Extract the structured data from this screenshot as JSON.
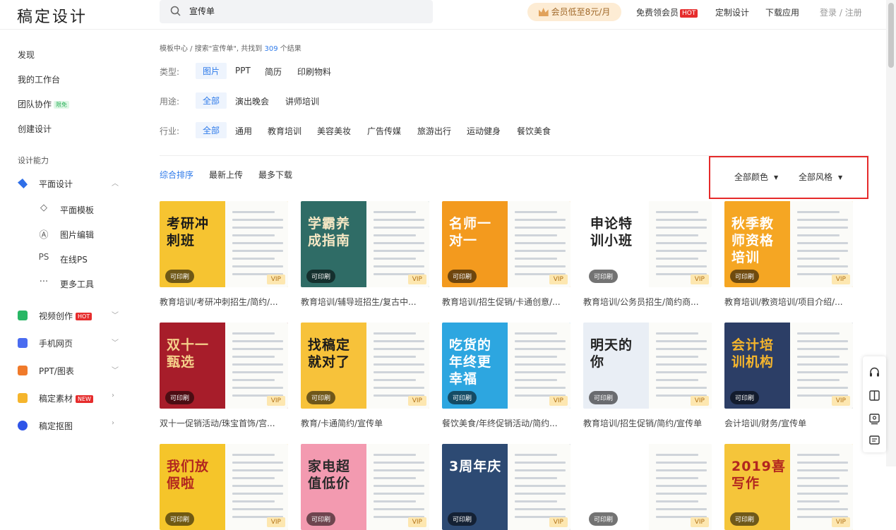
{
  "logo": "稿定设计",
  "search": {
    "value": "宣传单"
  },
  "header": {
    "vip": "会员低至8元/月",
    "free_vip": "免费领会员",
    "hot": "HOT",
    "custom": "定制设计",
    "download": "下载应用",
    "login": "登录",
    "sep": "/",
    "register": "注册"
  },
  "sidebar": {
    "discover": "发现",
    "workspace": "我的工作台",
    "team": "团队协作",
    "team_badge": "限免",
    "create": "创建设计",
    "section": "设计能力",
    "graphic": "平面设计",
    "sub": [
      {
        "icon": "layers-icon",
        "label": "平面模板"
      },
      {
        "icon": "edit-image-icon",
        "label": "图片编辑"
      },
      {
        "icon": "ps-icon",
        "label": "在线PS"
      },
      {
        "icon": "more-icon",
        "label": "更多工具"
      }
    ],
    "video": "视频创作",
    "video_badge": "HOT",
    "h5": "手机网页",
    "ppt": "PPT/图表",
    "material": "稿定素材",
    "material_badge": "NEW",
    "cutout": "稿定抠图"
  },
  "breadcrumb": {
    "prefix": "模板中心 / 搜索\"宣传单\", 共找到 ",
    "count": "309",
    "suffix": " 个结果"
  },
  "filters": {
    "type": {
      "label": "类型:",
      "options": [
        "图片",
        "PPT",
        "简历",
        "印刷物料"
      ]
    },
    "use": {
      "label": "用途:",
      "options": [
        "全部",
        "演出晚会",
        "讲师培训"
      ]
    },
    "industry": {
      "label": "行业:",
      "options": [
        "全部",
        "通用",
        "教育培训",
        "美容美妆",
        "广告传媒",
        "旅游出行",
        "运动健身",
        "餐饮美食"
      ]
    }
  },
  "sort": [
    "综合排序",
    "最新上传",
    "最多下载"
  ],
  "dropdowns": {
    "color": "全部颜色",
    "style": "全部风格"
  },
  "badges": {
    "print": "可印刷",
    "vip": "VIP"
  },
  "cards": [
    {
      "title": "教育培训/考研冲刺招生/简约/...",
      "big": "考研冲刺班",
      "bg": "#f6c431",
      "ink": "#1a1a1a"
    },
    {
      "title": "教育培训/辅导班招生/复古中...",
      "big": "学霸养成指南",
      "bg": "#2f6c66",
      "ink": "#f5e7c4"
    },
    {
      "title": "教育培训/招生促销/卡通创意/...",
      "big": "名师一对一",
      "bg": "#f39a1e",
      "ink": "#ffffff"
    },
    {
      "title": "教育培训/公务员招生/简约商...",
      "big": "申论特训小班",
      "bg": "#ffffff",
      "ink": "#222222"
    },
    {
      "title": "教育培训/教资培训/项目介绍/...",
      "big": "秋季教师资格培训",
      "bg": "#f5a623",
      "ink": "#ffffff"
    },
    {
      "title": "双十一促销活动/珠宝首饰/宫...",
      "big": "双十一甄选",
      "bg": "#a71d2a",
      "ink": "#f5d08a"
    },
    {
      "title": "教育/卡通简约/宣传单",
      "big": "找稿定就对了",
      "bg": "#f7c23a",
      "ink": "#1a1a1a"
    },
    {
      "title": "餐饮美食/年终促销活动/简约...",
      "big": "吃货的年终更幸福",
      "bg": "#2da6e0",
      "ink": "#ffffff"
    },
    {
      "title": "教育培训/招生促销/简约/宣传单",
      "big": "明天的你",
      "bg": "#e9eef5",
      "ink": "#222222"
    },
    {
      "title": "会计培训/财务/宣传单",
      "big": "会计培训机构",
      "bg": "#2c3e66",
      "ink": "#f5b52c"
    },
    {
      "title": "",
      "big": "我们放假啦",
      "bg": "#f5c52a",
      "ink": "#b2261f"
    },
    {
      "title": "",
      "big": "家电超值低价",
      "bg": "#f39ab0",
      "ink": "#2a2a2a"
    },
    {
      "title": "",
      "big": "3周年庆",
      "bg": "#2d4a73",
      "ink": "#ffffff"
    },
    {
      "title": "",
      "big": "",
      "bg": "#ffffff",
      "ink": "#222222"
    },
    {
      "title": "",
      "big": "2019喜写作",
      "bg": "#f5c53a",
      "ink": "#b2261f"
    }
  ]
}
